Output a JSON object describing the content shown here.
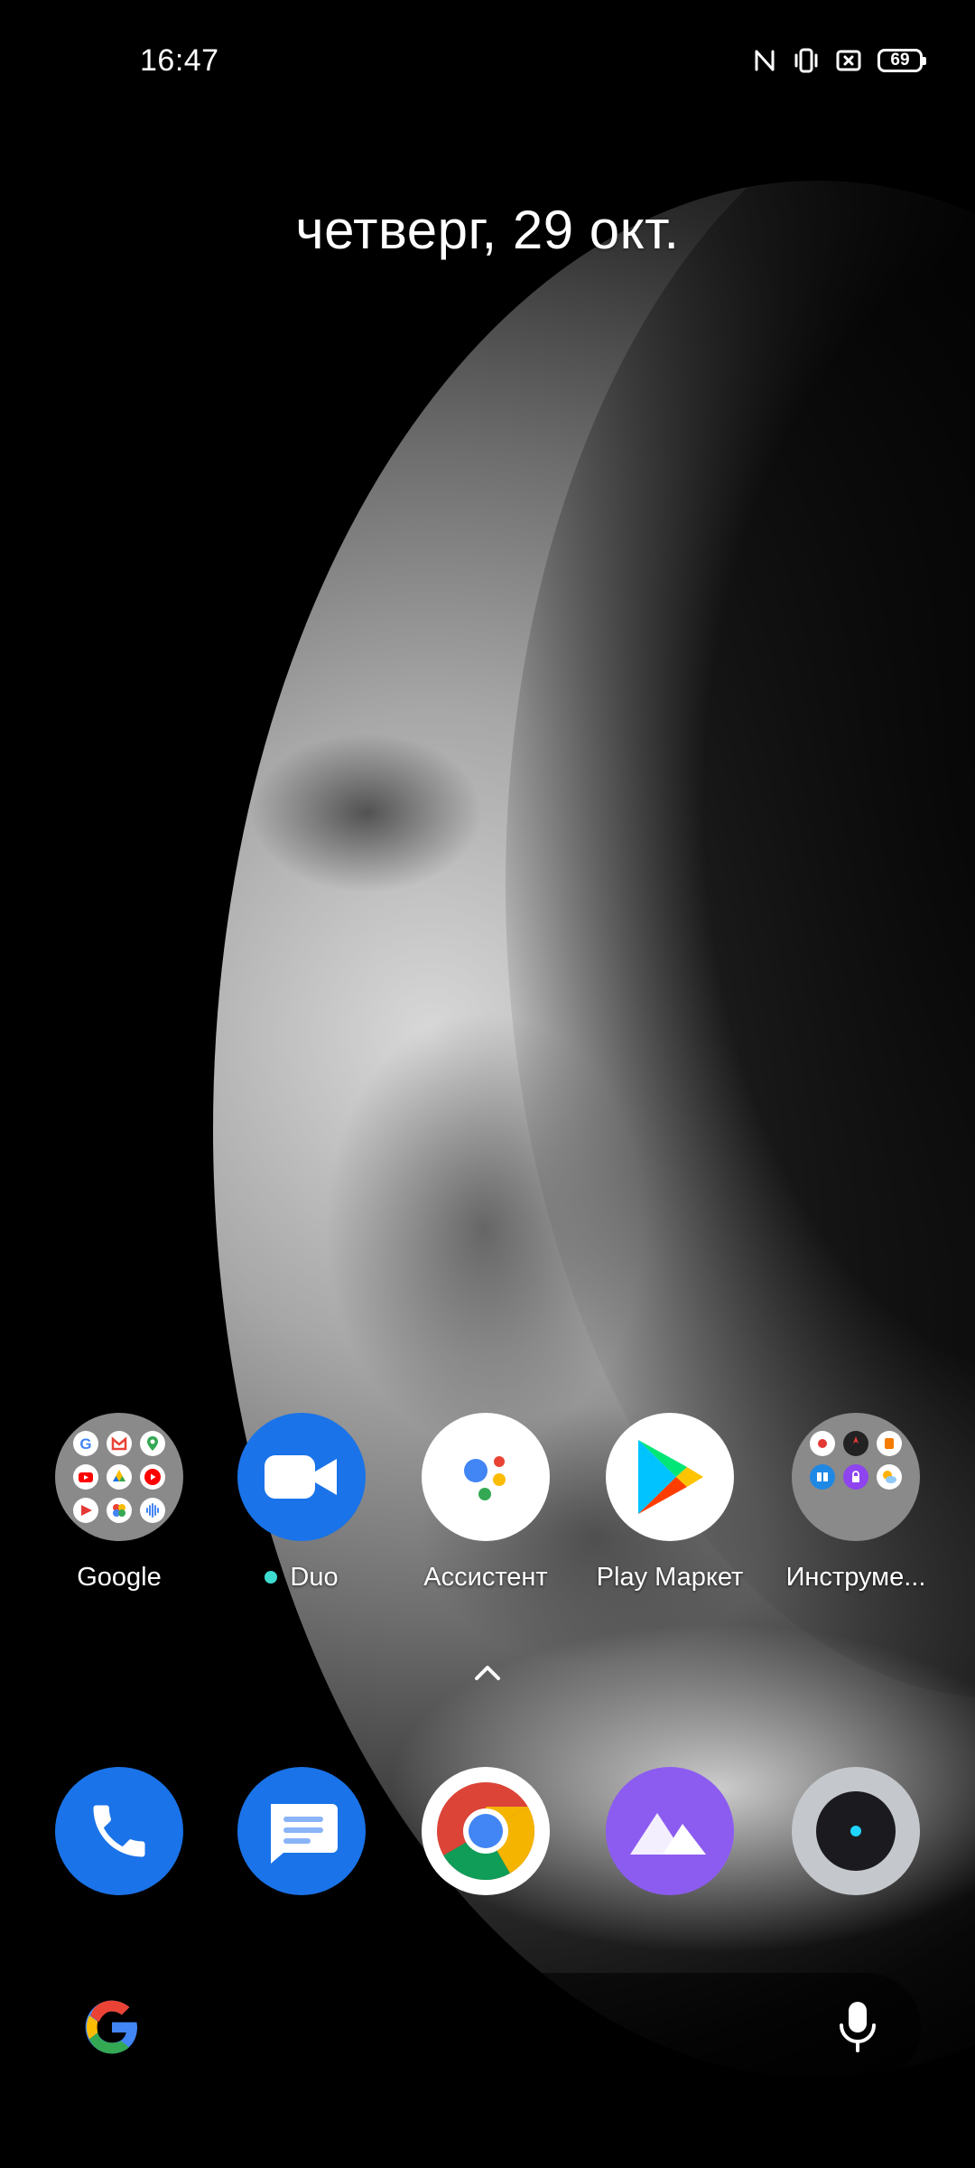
{
  "status_bar": {
    "time": "16:47",
    "battery_level": "69",
    "icons": [
      "nfc-icon",
      "vibrate-icon",
      "no-sim-icon",
      "battery-icon"
    ]
  },
  "date_widget": {
    "text": "четверг, 29 окт."
  },
  "home_apps": [
    {
      "label": "Google",
      "icon": "google-folder-icon",
      "type": "folder"
    },
    {
      "label": "Duo",
      "icon": "duo-icon",
      "new_badge": true
    },
    {
      "label": "Ассистент",
      "icon": "assistant-icon"
    },
    {
      "label": "Play Маркет",
      "icon": "play-store-icon"
    },
    {
      "label": "Инструме...",
      "icon": "tools-folder-icon",
      "type": "folder"
    }
  ],
  "app_drawer_handle": {
    "icon": "chevron-up-icon"
  },
  "dock": [
    {
      "name": "phone",
      "icon": "phone-icon",
      "color": "#1a73e8"
    },
    {
      "name": "messages",
      "icon": "messages-icon",
      "color": "#1a73e8"
    },
    {
      "name": "chrome",
      "icon": "chrome-icon"
    },
    {
      "name": "gallery",
      "icon": "gallery-icon",
      "color": "#8c5cf0"
    },
    {
      "name": "camera",
      "icon": "camera-icon",
      "color": "#c4c7cc"
    }
  ],
  "search_bar": {
    "logo_icon": "google-g-icon",
    "mic_icon": "mic-icon"
  }
}
